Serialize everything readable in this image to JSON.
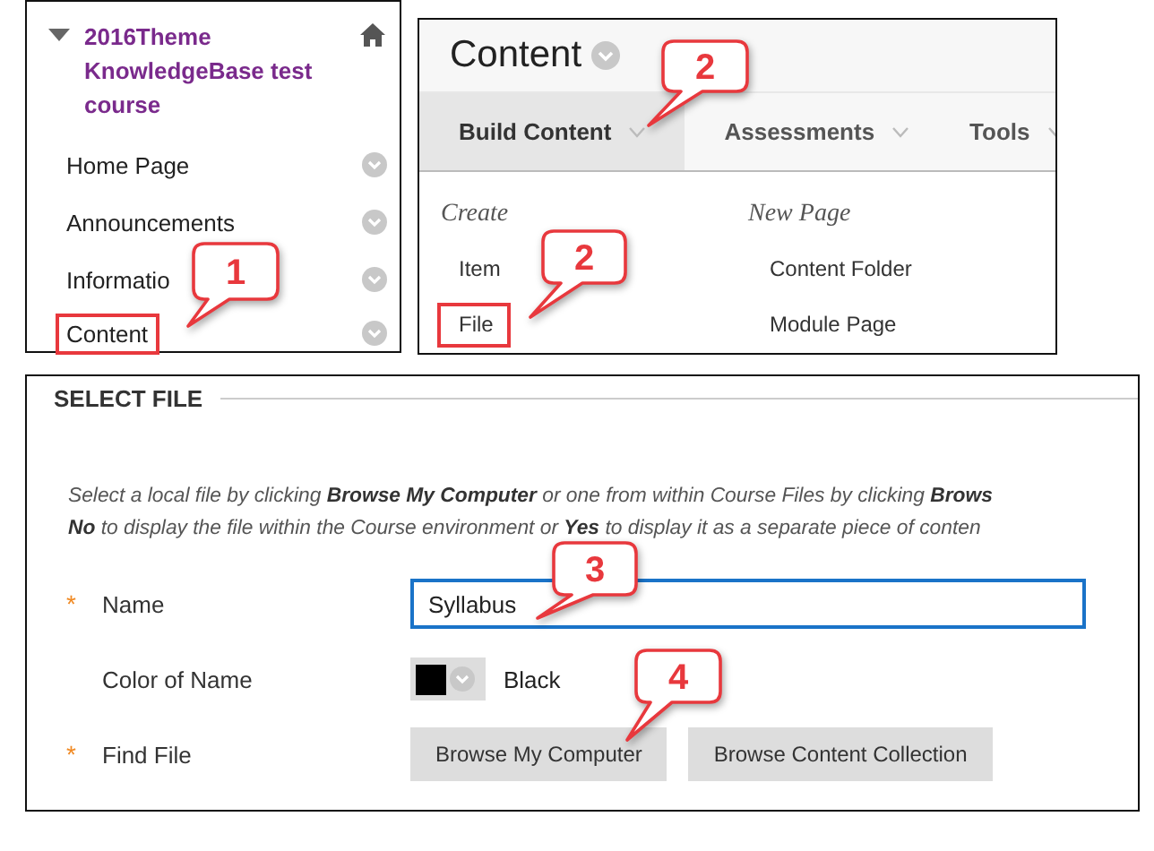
{
  "course_menu": {
    "title": "2016Theme KnowledgeBase test course",
    "expanded": true,
    "items": [
      {
        "label": "Home Page",
        "highlighted": false
      },
      {
        "label": "Announcements",
        "highlighted": false
      },
      {
        "label": "Informatio",
        "highlighted": false
      },
      {
        "label": "Content",
        "highlighted": true
      }
    ]
  },
  "content_page": {
    "title": "Content",
    "tabs": [
      {
        "label": "Build Content",
        "selected": true
      },
      {
        "label": "Assessments",
        "selected": false
      },
      {
        "label": "Tools",
        "selected": false
      }
    ],
    "menu_columns": [
      {
        "heading": "Create",
        "items": [
          {
            "label": "Item",
            "highlighted": false
          },
          {
            "label": "File",
            "highlighted": true
          }
        ]
      },
      {
        "heading": "New Page",
        "items": [
          {
            "label": "Content Folder",
            "highlighted": false
          },
          {
            "label": "Module Page",
            "highlighted": false
          }
        ]
      }
    ]
  },
  "select_file": {
    "heading": "SELECT FILE",
    "instructions": [
      "Select a local file by clicking **Browse My Computer** or one from within Course Files by clicking **Brows**",
      "**No** to display the file within the Course environment or **Yes** to display it as a separate piece of conten"
    ],
    "fields": [
      {
        "kind": "text",
        "required_mark": "*",
        "label": "Name",
        "value": "Syllabus"
      },
      {
        "kind": "color",
        "label": "Color of Name",
        "color": "#000000",
        "value": "Black"
      },
      {
        "kind": "buttons",
        "required_mark": "*",
        "label": "Find File",
        "buttons": [
          "Browse My Computer",
          "Browse Content Collection"
        ]
      }
    ]
  },
  "callouts": [
    {
      "number": "1"
    },
    {
      "number": "2"
    },
    {
      "number": "2"
    },
    {
      "number": "3"
    },
    {
      "number": "4"
    }
  ]
}
